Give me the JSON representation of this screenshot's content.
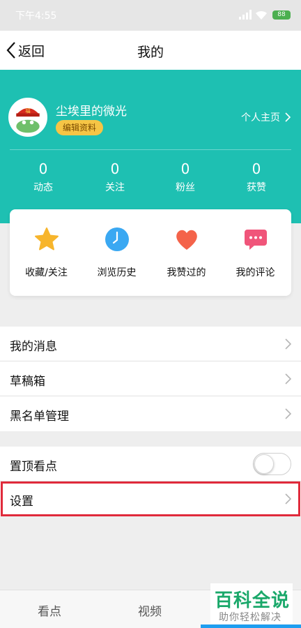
{
  "status_bar": {
    "time": "下午4:55",
    "battery": "88"
  },
  "nav": {
    "back_label": "返回",
    "title": "我的"
  },
  "profile": {
    "username": "尘埃里的微光",
    "edit_label": "编辑资料",
    "homepage_label": "个人主页"
  },
  "stats": [
    {
      "value": "0",
      "label": "动态"
    },
    {
      "value": "0",
      "label": "关注"
    },
    {
      "value": "0",
      "label": "粉丝"
    },
    {
      "value": "0",
      "label": "获赞"
    }
  ],
  "shortcuts": [
    {
      "label": "收藏/关注",
      "icon": "star-icon"
    },
    {
      "label": "浏览历史",
      "icon": "clock-icon"
    },
    {
      "label": "我赞过的",
      "icon": "heart-icon"
    },
    {
      "label": "我的评论",
      "icon": "comment-icon"
    }
  ],
  "menu_group_1": [
    {
      "label": "我的消息"
    },
    {
      "label": "草稿箱"
    },
    {
      "label": "黑名单管理"
    }
  ],
  "menu_group_2": {
    "pin_label": "置顶看点",
    "pin_enabled": false,
    "settings_label": "设置"
  },
  "tabbar": {
    "tabs": [
      {
        "label": "看点"
      },
      {
        "label": "视频"
      }
    ]
  },
  "watermark": {
    "main": "百科全说",
    "sub": "助你轻松解决"
  },
  "colors": {
    "teal": "#1ec0b2",
    "badge": "#f6c545",
    "highlight": "#e02a3b",
    "tab_accent": "#1e9ef0"
  }
}
